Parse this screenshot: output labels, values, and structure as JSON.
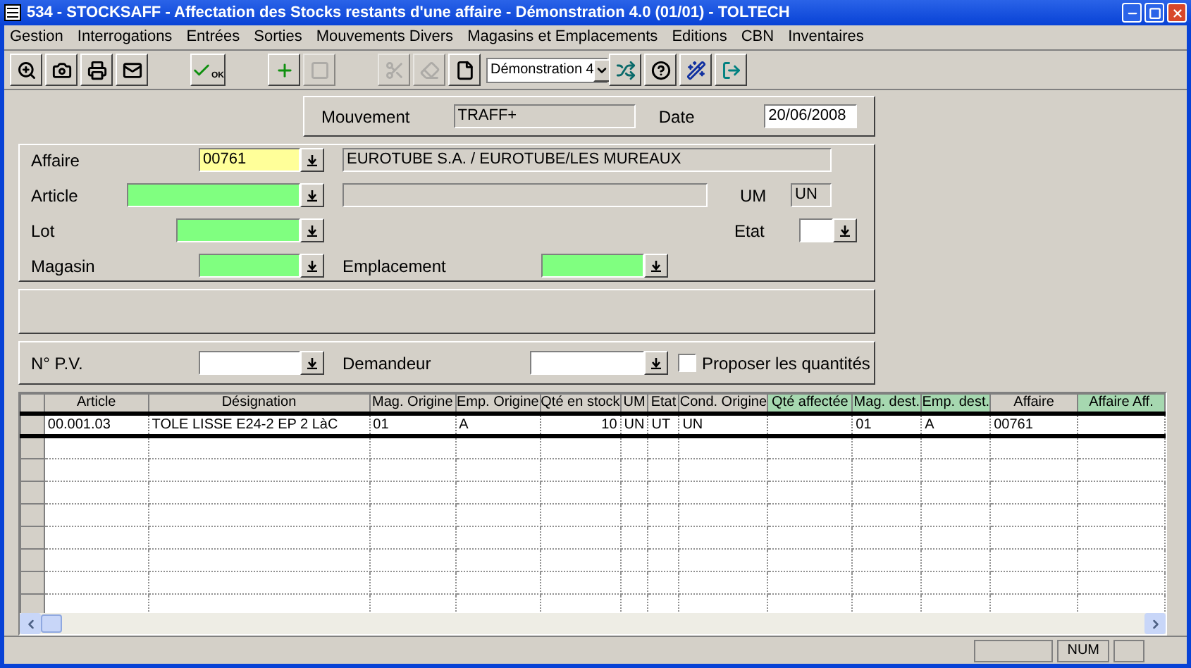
{
  "window": {
    "title": "534 - STOCKSAFF - Affectation des Stocks restants d'une affaire - Démonstration 4.0 (01/01) - TOLTECH"
  },
  "menu": [
    "Gestion",
    "Interrogations",
    "Entrées",
    "Sorties",
    "Mouvements Divers",
    "Magasins et Emplacements",
    "Editions",
    "CBN",
    "Inventaires"
  ],
  "toolbar": [
    {
      "kind": "preview",
      "disabled": false
    },
    {
      "kind": "camera",
      "disabled": false
    },
    {
      "kind": "print",
      "disabled": false
    },
    {
      "kind": "mail",
      "disabled": false
    },
    {
      "kind": "gap"
    },
    {
      "kind": "validate",
      "label": "OK",
      "disabled": false
    },
    {
      "kind": "gap"
    },
    {
      "kind": "add",
      "disabled": false
    },
    {
      "kind": "blank",
      "disabled": true
    },
    {
      "kind": "gap"
    },
    {
      "kind": "cut",
      "disabled": true
    },
    {
      "kind": "erase",
      "disabled": true
    },
    {
      "kind": "new",
      "disabled": false
    },
    {
      "kind": "select",
      "value": "Démonstration 4"
    },
    {
      "kind": "transfer",
      "disabled": false
    },
    {
      "kind": "help",
      "disabled": false
    },
    {
      "kind": "wand",
      "disabled": false
    },
    {
      "kind": "exit",
      "disabled": false
    }
  ],
  "header": {
    "mouvement_label": "Mouvement",
    "mouvement": "TRAFF+",
    "date_label": "Date",
    "date": "20/06/2008"
  },
  "form": {
    "affaire": {
      "label": "Affaire",
      "value": "00761",
      "color": "#ffff99",
      "description": "EUROTUBE S.A. / EUROTUBE/LES MUREAUX"
    },
    "article": {
      "label": "Article",
      "color": "#80ff80"
    },
    "um": {
      "label": "UM",
      "value": "UN"
    },
    "lot": {
      "label": "Lot",
      "color": "#80ff80"
    },
    "etat": {
      "label": "Etat",
      "color": "#ffffff"
    },
    "magasin": {
      "label": "Magasin",
      "color": "#80ff80"
    },
    "emplacement": {
      "label": "Emplacement",
      "color": "#80ff80"
    }
  },
  "filters": {
    "pv": {
      "label": "N° P.V.",
      "color": "#ffffff"
    },
    "demandeur": {
      "label": "Demandeur",
      "color": "#ffffff"
    },
    "proposer": {
      "label": "Proposer les quantités",
      "checked": false
    }
  },
  "table": {
    "columns": [
      {
        "label": "Article",
        "highlighted": false
      },
      {
        "label": "Désignation",
        "highlighted": false
      },
      {
        "label": "Mag. Origine",
        "highlighted": false
      },
      {
        "label": "Emp. Origine",
        "highlighted": false
      },
      {
        "label": "Qté en stock",
        "highlighted": false
      },
      {
        "label": "UM",
        "highlighted": false
      },
      {
        "label": "Etat",
        "highlighted": false
      },
      {
        "label": "Cond. Origine",
        "highlighted": false
      },
      {
        "label": "Qté affectée",
        "highlighted": true
      },
      {
        "label": "Mag. dest.",
        "highlighted": true
      },
      {
        "label": "Emp. dest.",
        "highlighted": true
      },
      {
        "label": "Affaire",
        "highlighted": false
      },
      {
        "label": "Affaire Aff.",
        "highlighted": true
      }
    ],
    "rows": [
      {
        "selected": true,
        "cells": [
          "00.001.03",
          "TOLE LISSE E24-2 EP 2 LàC",
          "01",
          "A",
          "10",
          "UN",
          "UT",
          "UN",
          null,
          "01",
          "A",
          "00761",
          null
        ]
      }
    ]
  },
  "status_bar": {
    "num": "NUM"
  }
}
